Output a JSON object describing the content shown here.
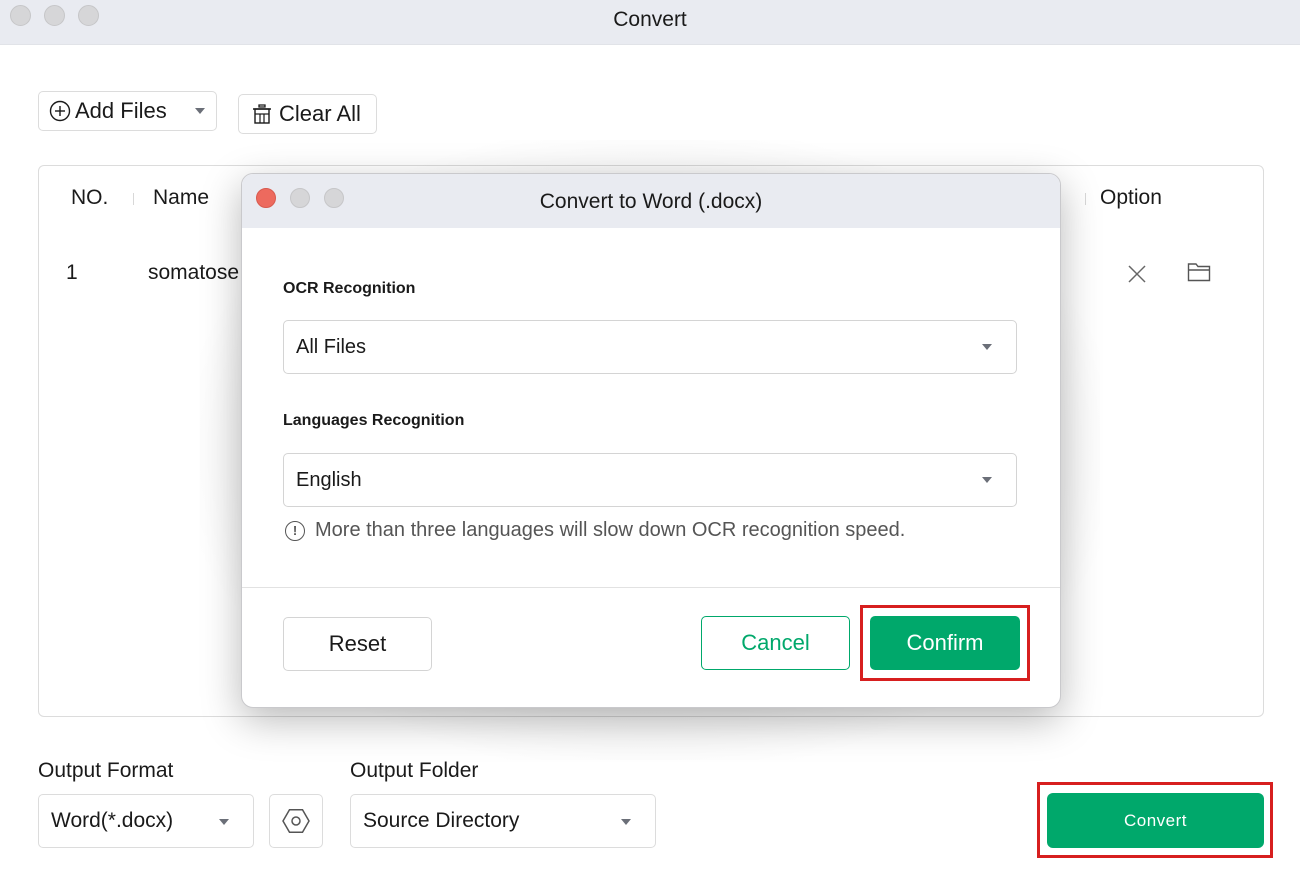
{
  "window": {
    "title": "Convert"
  },
  "toolbar": {
    "add_files_label": "Add Files",
    "clear_all_label": "Clear All"
  },
  "table": {
    "columns": [
      "NO.",
      "Name",
      "Option"
    ],
    "rows": [
      {
        "no": "1",
        "name": "somatose"
      }
    ]
  },
  "bottom": {
    "output_format_label": "Output Format",
    "output_format_value": "Word(*.docx)",
    "output_folder_label": "Output Folder",
    "output_folder_value": "Source Directory",
    "convert_label": "Convert"
  },
  "dialog": {
    "title": "Convert to Word (.docx)",
    "ocr_label": "OCR Recognition",
    "ocr_value": "All Files",
    "languages_label": "Languages Recognition",
    "languages_value": "English",
    "hint": "More than three languages will slow down OCR recognition speed.",
    "reset_label": "Reset",
    "cancel_label": "Cancel",
    "confirm_label": "Confirm"
  },
  "colors": {
    "accent": "#00a86b",
    "highlight": "#d71f1f",
    "close_dot": "#ed6a5e"
  }
}
